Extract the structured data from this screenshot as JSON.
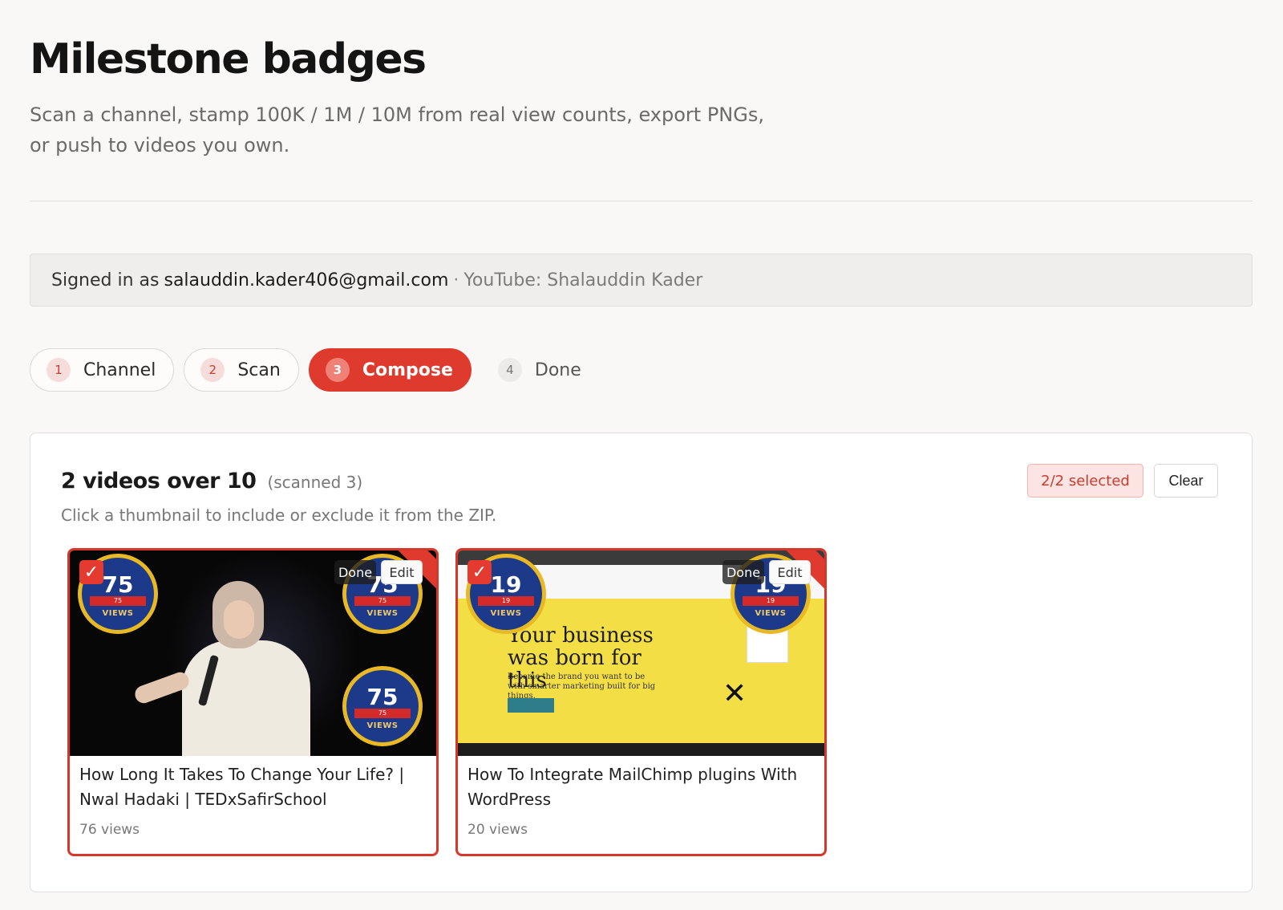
{
  "header": {
    "title": "Milestone badges",
    "subtitle": "Scan a channel, stamp 100K / 1M / 10M from real view counts, export PNGs, or push to videos you own."
  },
  "account": {
    "prefix": "Signed in as",
    "email": "salauddin.kader406@gmail.com",
    "separator": "·",
    "youtube": "YouTube: Shalauddin Kader"
  },
  "steps": [
    {
      "num": "1",
      "label": "Channel",
      "state": "completed"
    },
    {
      "num": "2",
      "label": "Scan",
      "state": "completed"
    },
    {
      "num": "3",
      "label": "Compose",
      "state": "active"
    },
    {
      "num": "4",
      "label": "Done",
      "state": "pending"
    }
  ],
  "results": {
    "title": "2 videos over 10",
    "scanned": "(scanned 3)",
    "hint": "Click a thumbnail to include or exclude it from the ZIP.",
    "selected_label": "2/2 selected",
    "clear_label": "Clear"
  },
  "videos": [
    {
      "title": "How Long It Takes To Change Your Life? | Nwal Hadaki | TEDxSafirSchool",
      "views": "76 views",
      "badge_number": "75",
      "badge_small": "75",
      "badge_word": "VIEWS",
      "check": "✓",
      "done_label": "Done",
      "edit_label": "Edit",
      "selected": true
    },
    {
      "title": "How To Integrate MailChimp plugins With WordPress",
      "views": "20 views",
      "badge_number": "19",
      "badge_small": "19",
      "badge_word": "VIEWS",
      "check": "✓",
      "done_label": "Done",
      "edit_label": "Edit",
      "selected": true,
      "thumbnail_text": {
        "headline": "Your business was born for this",
        "body": "Become the brand you want to be with smarter marketing built for big things."
      }
    }
  ],
  "colors": {
    "accent": "#de3a2e",
    "accent_soft": "#fbe4e2",
    "badge_blue": "#1d3a8a",
    "badge_gold": "#e9b923"
  },
  "icons": {
    "check": "check-icon"
  }
}
